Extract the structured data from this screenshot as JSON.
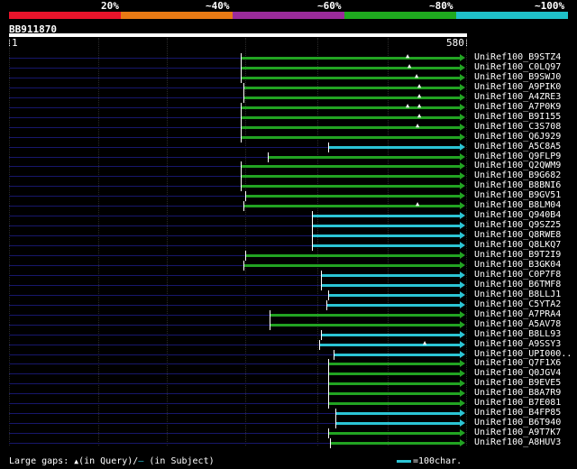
{
  "legend": {
    "colors": [
      "#e8142b",
      "#e87a14",
      "#9b2b9b",
      "#1faa1f",
      "#1fc0c8"
    ],
    "labels": [
      "20%",
      "~40%",
      "~60%",
      "~80%",
      "~100%"
    ]
  },
  "query": {
    "id": "BB911870",
    "start": "1",
    "end": "580"
  },
  "identity_colors": {
    "green": "#22a322",
    "cyan": "#2bc4d4"
  },
  "rows": [
    {
      "label": "UniRef100_B9STZ4",
      "color": "green",
      "start": 267,
      "gaps": [
        452
      ]
    },
    {
      "label": "UniRef100_C0LQ97",
      "color": "green",
      "start": 267,
      "gaps": [
        454
      ]
    },
    {
      "label": "UniRef100_B9SWJ0",
      "color": "green",
      "start": 267,
      "gaps": [
        462
      ]
    },
    {
      "label": "UniRef100_A9PIK0",
      "color": "green",
      "start": 270,
      "gaps": [
        465
      ]
    },
    {
      "label": "UniRef100_A4ZRE3",
      "color": "green",
      "start": 270,
      "gaps": [
        465
      ]
    },
    {
      "label": "UniRef100_A7P0K9",
      "color": "green",
      "start": 267,
      "gaps": [
        452,
        465
      ]
    },
    {
      "label": "UniRef100_B9I155",
      "color": "green",
      "start": 267,
      "gaps": [
        465
      ]
    },
    {
      "label": "UniRef100_C3S708",
      "color": "green",
      "start": 267,
      "gaps": [
        463
      ]
    },
    {
      "label": "UniRef100_Q6J929",
      "color": "green",
      "start": 267,
      "gaps": []
    },
    {
      "label": "UniRef100_A5C8A5",
      "color": "cyan",
      "start": 364,
      "gaps": []
    },
    {
      "label": "UniRef100_Q9FLP9",
      "color": "green",
      "start": 297,
      "gaps": []
    },
    {
      "label": "UniRef100_Q2QWM9",
      "color": "green",
      "start": 267,
      "gaps": []
    },
    {
      "label": "UniRef100_B9G682",
      "color": "green",
      "start": 267,
      "gaps": []
    },
    {
      "label": "UniRef100_B8BNI6",
      "color": "green",
      "start": 267,
      "gaps": []
    },
    {
      "label": "UniRef100_B9GV51",
      "color": "green",
      "start": 272,
      "gaps": []
    },
    {
      "label": "UniRef100_B8LM04",
      "color": "green",
      "start": 270,
      "gaps": [
        463
      ]
    },
    {
      "label": "UniRef100_Q940B4",
      "color": "cyan",
      "start": 346,
      "gaps": []
    },
    {
      "label": "UniRef100_Q9SZ25",
      "color": "cyan",
      "start": 346,
      "gaps": []
    },
    {
      "label": "UniRef100_Q8RWE8",
      "color": "cyan",
      "start": 346,
      "gaps": []
    },
    {
      "label": "UniRef100_Q8LKQ7",
      "color": "cyan",
      "start": 346,
      "gaps": []
    },
    {
      "label": "UniRef100_B9T2I9",
      "color": "green",
      "start": 272,
      "gaps": []
    },
    {
      "label": "UniRef100_B3GK04",
      "color": "green",
      "start": 270,
      "gaps": []
    },
    {
      "label": "UniRef100_C0P7F8",
      "color": "cyan",
      "start": 356,
      "gaps": []
    },
    {
      "label": "UniRef100_B6TMF8",
      "color": "cyan",
      "start": 356,
      "gaps": []
    },
    {
      "label": "UniRef100_B8LLJ1",
      "color": "cyan",
      "start": 364,
      "gaps": []
    },
    {
      "label": "UniRef100_C5YTA2",
      "color": "cyan",
      "start": 362,
      "gaps": []
    },
    {
      "label": "UniRef100_A7PRA4",
      "color": "green",
      "start": 299,
      "gaps": []
    },
    {
      "label": "UniRef100_A5AV78",
      "color": "green",
      "start": 299,
      "gaps": []
    },
    {
      "label": "UniRef100_B8LL93",
      "color": "cyan",
      "start": 356,
      "gaps": []
    },
    {
      "label": "UniRef100_A9SSY3",
      "color": "cyan",
      "start": 354,
      "gaps": [
        471
      ]
    },
    {
      "label": "UniRef100_UPI000..",
      "color": "cyan",
      "start": 370,
      "gaps": []
    },
    {
      "label": "UniRef100_Q7F1X6",
      "color": "green",
      "start": 364,
      "gaps": []
    },
    {
      "label": "UniRef100_Q0JGV4",
      "color": "green",
      "start": 364,
      "gaps": []
    },
    {
      "label": "UniRef100_B9EVE5",
      "color": "green",
      "start": 364,
      "gaps": []
    },
    {
      "label": "UniRef100_B8A7R9",
      "color": "green",
      "start": 364,
      "gaps": []
    },
    {
      "label": "UniRef100_B7E081",
      "color": "green",
      "start": 364,
      "gaps": []
    },
    {
      "label": "UniRef100_B4FP85",
      "color": "cyan",
      "start": 372,
      "gaps": []
    },
    {
      "label": "UniRef100_B6T940",
      "color": "cyan",
      "start": 372,
      "gaps": []
    },
    {
      "label": "UniRef100_A9T7K7",
      "color": "green",
      "start": 364,
      "gaps": []
    },
    {
      "label": "UniRef100_A8HUV3",
      "color": "green",
      "start": 366,
      "gaps": []
    }
  ],
  "footer": {
    "gaps_label": "Large gaps: ",
    "query_symbol": "▲",
    "query_text": "(in Query)/",
    "subject_symbol": "—",
    "subject_text": " (in Subject)",
    "scale_text": "=100char."
  }
}
